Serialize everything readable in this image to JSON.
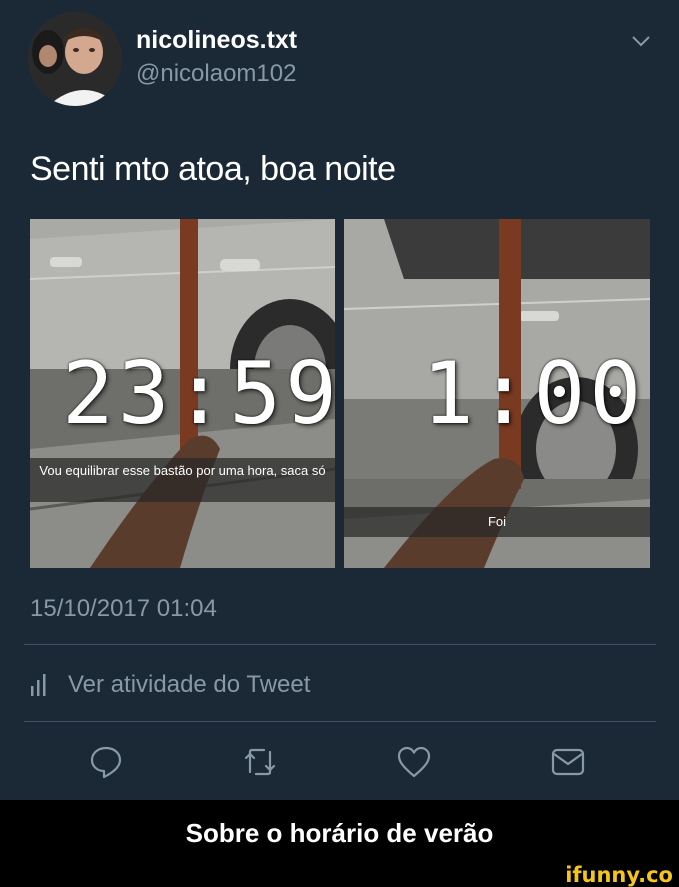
{
  "tweet": {
    "display_name": "nicolineos.txt",
    "handle": "@nicolaom102",
    "text": "Senti mto atoa, boa noite",
    "timestamp": "15/10/2017 01:04",
    "activity_label": "Ver atividade do Tweet"
  },
  "photos": [
    {
      "clock": "23:59",
      "caption": "Vou equilibrar esse bastão por uma hora, saca só"
    },
    {
      "clock": "1:00",
      "caption": "Foi"
    }
  ],
  "actions": {
    "reply_icon": "reply-icon",
    "retweet_icon": "retweet-icon",
    "like_icon": "heart-icon",
    "dm_icon": "envelope-icon"
  },
  "meme_caption": "Sobre o horário de verão",
  "watermark": "ifunny.co",
  "colors": {
    "background": "#1b2836",
    "secondary_text": "#8899a6",
    "divider": "#3d5166",
    "watermark": "#f5c518"
  }
}
